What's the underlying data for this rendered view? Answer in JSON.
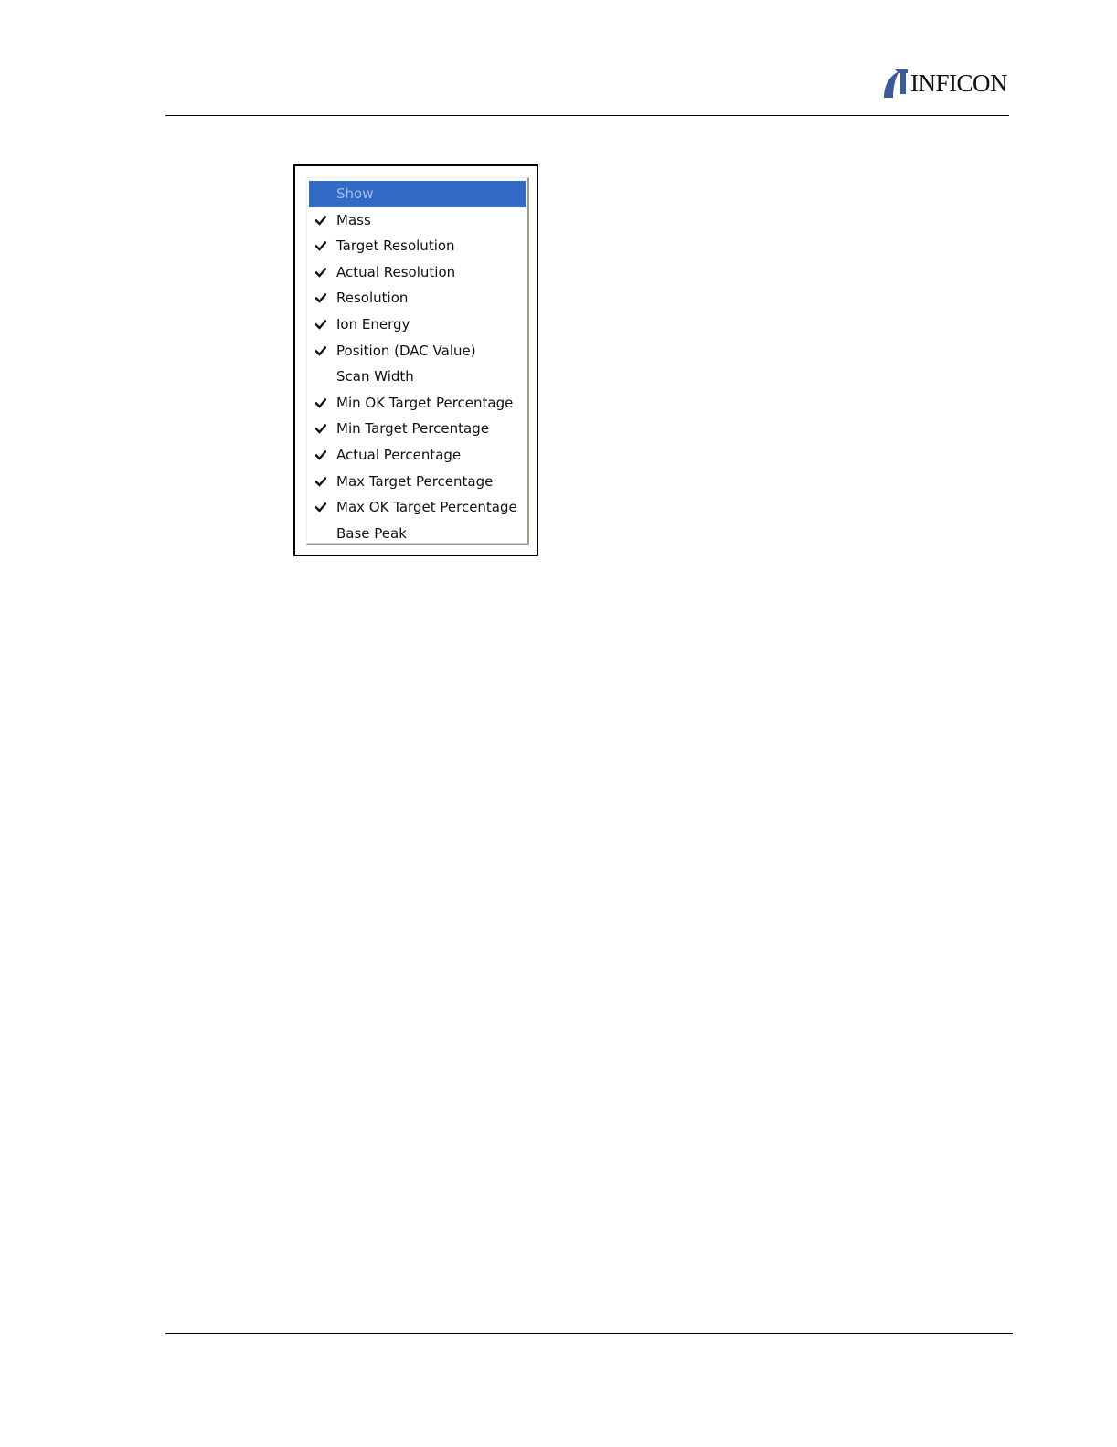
{
  "header": {
    "brand": "INFICON"
  },
  "menu": {
    "title": "Show",
    "items": [
      {
        "label": "Mass",
        "checked": true
      },
      {
        "label": "Target Resolution",
        "checked": true
      },
      {
        "label": "Actual Resolution",
        "checked": true
      },
      {
        "label": "Resolution",
        "checked": true
      },
      {
        "label": "Ion Energy",
        "checked": true
      },
      {
        "label": "Position (DAC Value)",
        "checked": true
      },
      {
        "label": "Scan Width",
        "checked": false
      },
      {
        "label": "Min OK Target Percentage",
        "checked": true
      },
      {
        "label": "Min Target Percentage",
        "checked": true
      },
      {
        "label": "Actual Percentage",
        "checked": true
      },
      {
        "label": "Max Target Percentage",
        "checked": true
      },
      {
        "label": "Max OK Target Percentage",
        "checked": true
      },
      {
        "label": "Base Peak",
        "checked": false
      }
    ]
  },
  "colors": {
    "highlight": "#316ac5",
    "logo_mark": "#3b5a9a"
  }
}
